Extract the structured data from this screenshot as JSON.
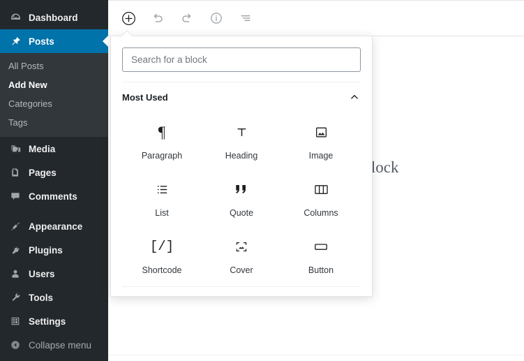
{
  "sidebar": {
    "items": [
      {
        "label": "Dashboard",
        "icon": "dashboard-icon",
        "state": "normal"
      },
      {
        "label": "Posts",
        "icon": "pin-icon",
        "state": "active"
      },
      {
        "label": "Media",
        "icon": "media-icon",
        "state": "normal"
      },
      {
        "label": "Pages",
        "icon": "pages-icon",
        "state": "normal"
      },
      {
        "label": "Comments",
        "icon": "comment-icon",
        "state": "normal"
      },
      {
        "label": "Appearance",
        "icon": "appearance-icon",
        "state": "normal"
      },
      {
        "label": "Plugins",
        "icon": "plugin-icon",
        "state": "normal"
      },
      {
        "label": "Users",
        "icon": "users-icon",
        "state": "normal"
      },
      {
        "label": "Tools",
        "icon": "tools-icon",
        "state": "normal"
      },
      {
        "label": "Settings",
        "icon": "settings-icon",
        "state": "normal"
      },
      {
        "label": "Collapse menu",
        "icon": "collapse-icon",
        "state": "dim"
      }
    ],
    "submenu": [
      {
        "label": "All Posts",
        "current": false
      },
      {
        "label": "Add New",
        "current": true
      },
      {
        "label": "Categories",
        "current": false
      },
      {
        "label": "Tags",
        "current": false
      }
    ],
    "colors": {
      "background": "#23282d",
      "submenu_background": "#32373c",
      "active": "#0073aa"
    }
  },
  "toolbar": {
    "buttons": [
      {
        "name": "add-block-button",
        "icon": "plus-circle-icon",
        "label": "Add block"
      },
      {
        "name": "undo-button",
        "icon": "undo-icon",
        "label": "Undo"
      },
      {
        "name": "redo-button",
        "icon": "redo-icon",
        "label": "Redo"
      },
      {
        "name": "content-info-button",
        "icon": "info-circle-icon",
        "label": "Content structure"
      },
      {
        "name": "block-navigation-button",
        "icon": "list-view-icon",
        "label": "Block navigation"
      }
    ]
  },
  "canvas": {
    "placeholder_text": "hoose a block"
  },
  "inserter": {
    "search": {
      "placeholder": "Search for a block",
      "value": ""
    },
    "panel": {
      "title": "Most Used",
      "collapse_icon": "chevron-up-icon",
      "expanded": true
    },
    "blocks": [
      {
        "label": "Paragraph",
        "icon": "paragraph-icon"
      },
      {
        "label": "Heading",
        "icon": "heading-icon"
      },
      {
        "label": "Image",
        "icon": "image-icon"
      },
      {
        "label": "List",
        "icon": "list-icon"
      },
      {
        "label": "Quote",
        "icon": "quote-icon"
      },
      {
        "label": "Columns",
        "icon": "columns-icon"
      },
      {
        "label": "Shortcode",
        "icon": "shortcode-icon"
      },
      {
        "label": "Cover",
        "icon": "cover-icon"
      },
      {
        "label": "Button",
        "icon": "button-icon"
      }
    ]
  }
}
